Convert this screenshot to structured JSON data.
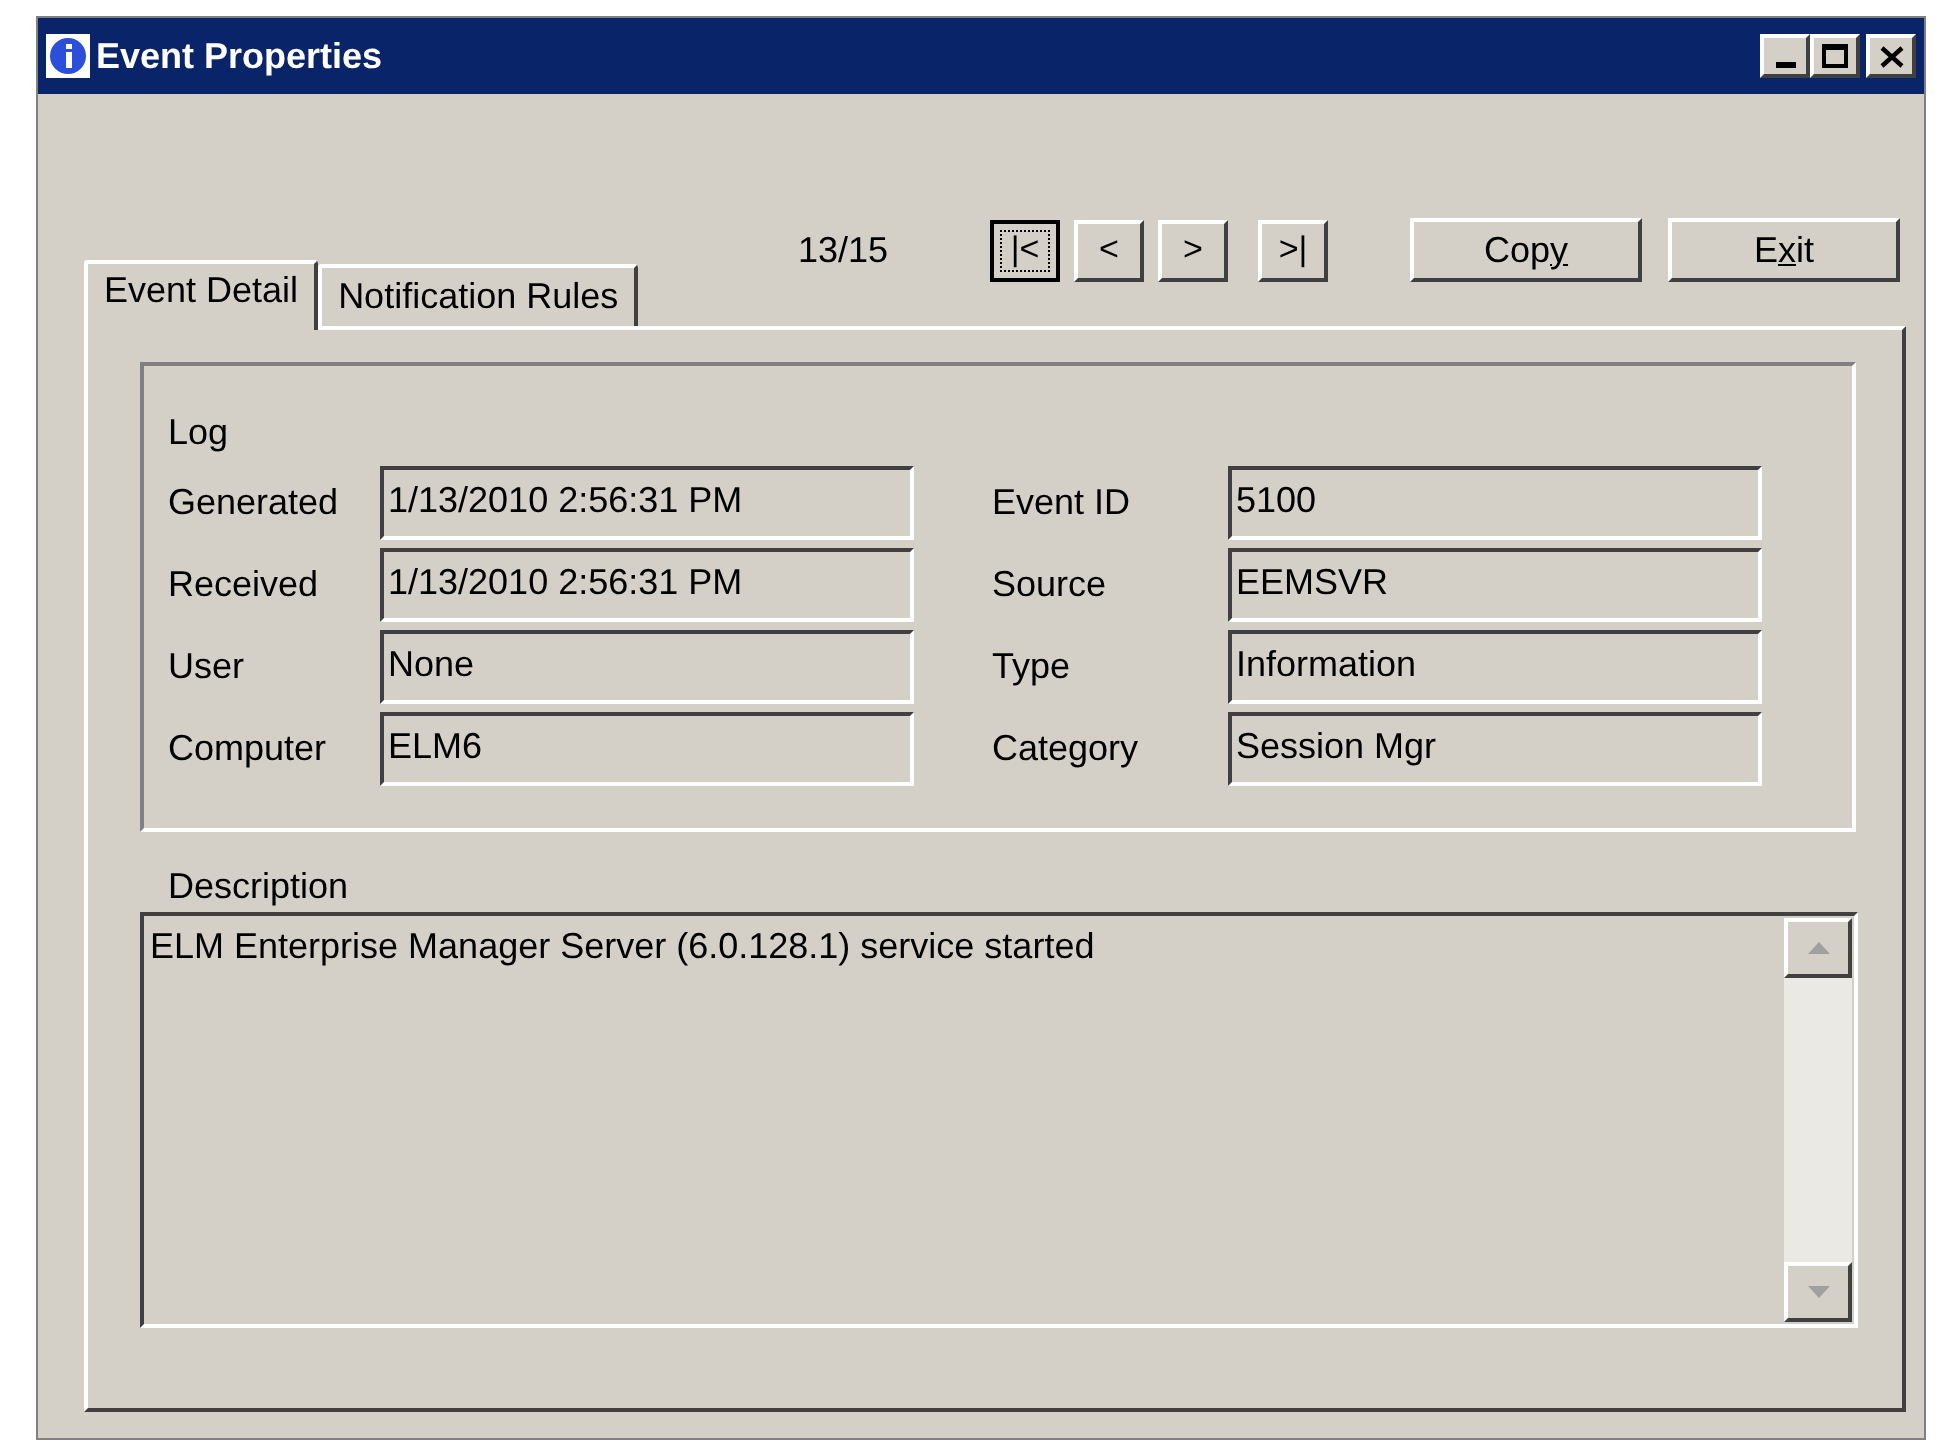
{
  "window": {
    "title": "Event Properties"
  },
  "navigator": {
    "position": "13/15",
    "buttons": [
      {
        "glyph": "|<",
        "focused": true
      },
      {
        "glyph": "<",
        "focused": false
      },
      {
        "glyph": ">",
        "focused": false
      },
      {
        "glyph": ">|",
        "focused": false
      }
    ]
  },
  "buttons": [
    {
      "text_before": "Cop",
      "access_key": "y"
    },
    {
      "text_before": "E",
      "access_key": "x",
      "text_after": "it"
    }
  ],
  "tabs": [
    {
      "label": "Event Detail",
      "selected": true
    },
    {
      "label": "Notification Rules",
      "selected": false
    }
  ],
  "log": {
    "title": "Log",
    "left_fields": [
      {
        "label": "Generated",
        "value": "1/13/2010 2:56:31 PM"
      },
      {
        "label": "Received",
        "value": "1/13/2010 2:56:31 PM"
      },
      {
        "label": "User",
        "value": "None"
      },
      {
        "label": "Computer",
        "value": "ELM6"
      }
    ],
    "right_fields": [
      {
        "label": "Event ID",
        "value": "5100"
      },
      {
        "label": "Source",
        "value": "EEMSVR"
      },
      {
        "label": "Type",
        "value": "Information"
      },
      {
        "label": "Category",
        "value": "Session Mgr"
      }
    ]
  },
  "description": {
    "label": "Description",
    "value": "ELM Enterprise Manager Server (6.0.128.1) service started"
  }
}
